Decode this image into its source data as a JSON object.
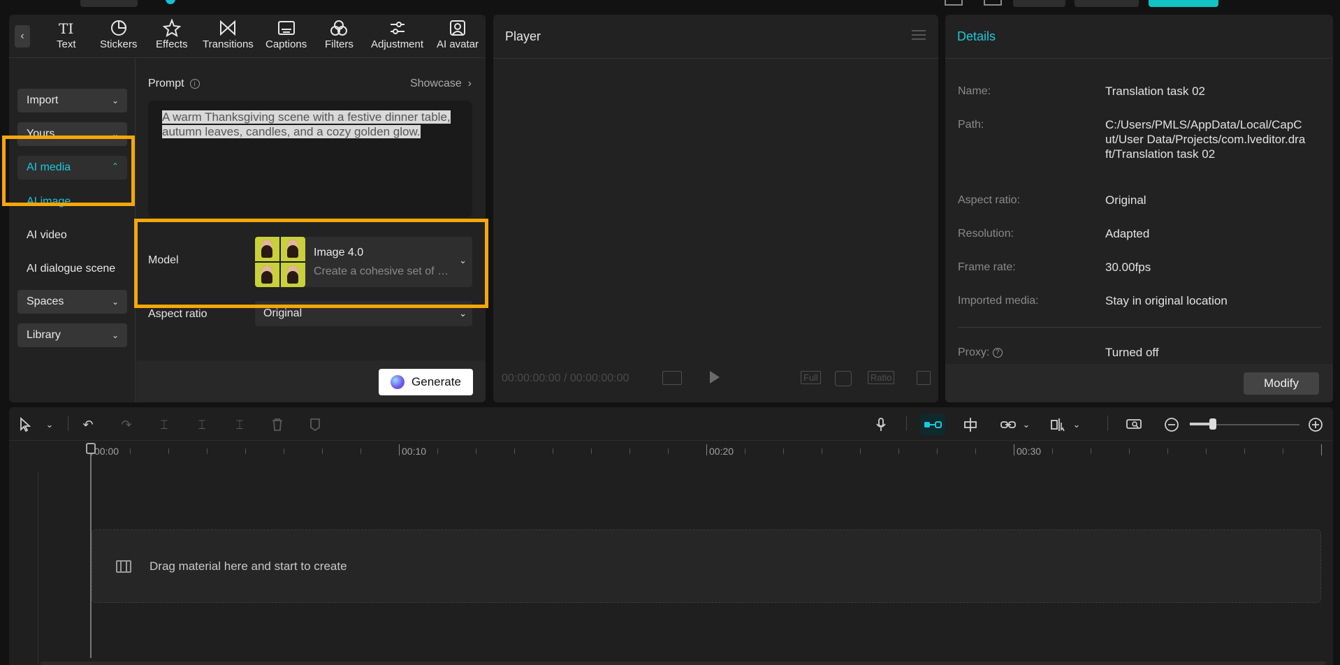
{
  "toolbar": {
    "tabs": [
      {
        "label": "Text",
        "icon": "text-icon"
      },
      {
        "label": "Stickers",
        "icon": "stickers-icon"
      },
      {
        "label": "Effects",
        "icon": "effects-icon"
      },
      {
        "label": "Transitions",
        "icon": "transitions-icon"
      },
      {
        "label": "Captions",
        "icon": "captions-icon"
      },
      {
        "label": "Filters",
        "icon": "filters-icon"
      },
      {
        "label": "Adjustment",
        "icon": "adjustment-icon"
      },
      {
        "label": "AI avatar",
        "icon": "ai-avatar-icon"
      }
    ]
  },
  "sidebar": {
    "import": "Import",
    "yours": "Yours",
    "ai_media": "AI media",
    "ai_image": "AI image",
    "ai_video": "AI video",
    "ai_dialogue": "AI dialogue scene",
    "spaces": "Spaces",
    "library": "Library"
  },
  "ai_image": {
    "prompt_label": "Prompt",
    "showcase": "Showcase",
    "prompt_text": "A warm Thanksgiving scene with a festive dinner table, autumn leaves, candles, and a cozy golden glow.",
    "model_label": "Model",
    "model_name": "Image 4.0",
    "model_desc": "Create a cohesive set of images",
    "ratio_label": "Aspect ratio",
    "ratio_value": "Original",
    "generate": "Generate"
  },
  "player": {
    "title": "Player",
    "current_time": "00:00:00:00",
    "total_time": "00:00:00:00",
    "full": "Full",
    "ratio": "Ratio"
  },
  "details": {
    "title": "Details",
    "rows": [
      {
        "key": "Name:",
        "value": "Translation task 02"
      },
      {
        "key": "Path:",
        "value": "C:/Users/PMLS/AppData/Local/CapCut/User Data/Projects/com.lveditor.draft/Translation task 02"
      },
      {
        "key": "Aspect ratio:",
        "value": "Original"
      },
      {
        "key": "Resolution:",
        "value": "Adapted"
      },
      {
        "key": "Frame rate:",
        "value": "30.00fps"
      },
      {
        "key": "Imported media:",
        "value": "Stay in original location"
      },
      {
        "key": "Proxy:",
        "value": "Turned off"
      }
    ],
    "modify": "Modify"
  },
  "timeline": {
    "ruler_labels": [
      "00:00",
      "00:10",
      "00:20",
      "00:30"
    ],
    "drop_hint": "Drag material here and start to create"
  },
  "colors": {
    "accent": "#1ec8db",
    "highlight": "#f5a70a"
  }
}
